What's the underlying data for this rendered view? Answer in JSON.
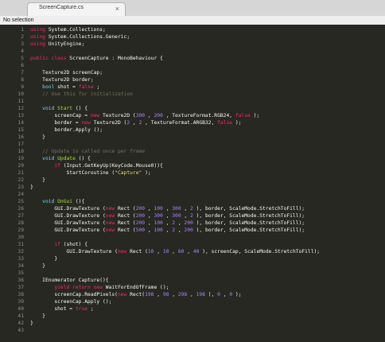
{
  "tab": {
    "label": "ScreenCapture.cs",
    "close_symbol": "×"
  },
  "status": {
    "text": "No selection"
  },
  "colors": {
    "background": "#272822",
    "keyword": "#f92672",
    "type": "#66d9ef",
    "number": "#ae81ff",
    "string": "#e6db74",
    "comment": "#75715e",
    "function": "#a6e22e",
    "text": "#f8f8f2"
  },
  "code": [
    {
      "n": "1",
      "segs": [
        [
          "kw",
          "using"
        ],
        [
          "",
          "System.Collections;"
        ]
      ]
    },
    {
      "n": "2",
      "segs": [
        [
          "kw",
          "using"
        ],
        [
          "",
          "System.Collections.Generic;"
        ]
      ]
    },
    {
      "n": "3",
      "segs": [
        [
          "kw",
          "using"
        ],
        [
          "",
          "UnityEngine;"
        ]
      ]
    },
    {
      "n": "4",
      "segs": []
    },
    {
      "n": "5",
      "segs": [
        [
          "kw",
          "public class"
        ],
        [
          "",
          "ScreenCapture : MonoBehaviour {"
        ]
      ]
    },
    {
      "n": "6",
      "segs": []
    },
    {
      "n": "7",
      "segs": [
        [
          "",
          "    Texture2D screenCap;"
        ]
      ]
    },
    {
      "n": "8",
      "segs": [
        [
          "",
          "    Texture2D border;"
        ]
      ]
    },
    {
      "n": "9",
      "segs": [
        [
          "ty",
          "    bool"
        ],
        [
          "",
          " shot = "
        ],
        [
          "kw",
          "false"
        ],
        [
          "",
          ";"
        ]
      ]
    },
    {
      "n": "10",
      "segs": [
        [
          "cmt",
          "    // Use this for initialization"
        ]
      ]
    },
    {
      "n": "11",
      "segs": []
    },
    {
      "n": "12",
      "segs": [
        [
          "ty",
          "    void"
        ],
        [
          "fn",
          " Start"
        ],
        [
          "",
          " () {"
        ]
      ]
    },
    {
      "n": "13",
      "segs": [
        [
          "",
          "        screenCap = "
        ],
        [
          "kw",
          "new"
        ],
        [
          "",
          " Texture2D ("
        ],
        [
          "num",
          "300"
        ],
        [
          "",
          ", "
        ],
        [
          "num",
          "200"
        ],
        [
          "",
          ", TextureFormat.RGB24, "
        ],
        [
          "kw",
          "false"
        ],
        [
          "",
          ");"
        ]
      ]
    },
    {
      "n": "14",
      "segs": [
        [
          "",
          "        border = "
        ],
        [
          "kw",
          "new"
        ],
        [
          "",
          " Texture2D ("
        ],
        [
          "num",
          "2"
        ],
        [
          "",
          ", "
        ],
        [
          "num",
          "2"
        ],
        [
          "",
          ", TextureFormat.ARGB32, "
        ],
        [
          "kw",
          "false"
        ],
        [
          "",
          ");"
        ]
      ]
    },
    {
      "n": "15",
      "segs": [
        [
          "",
          "        border.Apply ();"
        ]
      ]
    },
    {
      "n": "16",
      "segs": [
        [
          "",
          "    }"
        ]
      ]
    },
    {
      "n": "17",
      "segs": []
    },
    {
      "n": "18",
      "segs": [
        [
          "cmt",
          "    // Update is called once per frame"
        ]
      ]
    },
    {
      "n": "19",
      "segs": [
        [
          "ty",
          "    void"
        ],
        [
          "fn",
          " Update"
        ],
        [
          "",
          " () {"
        ]
      ]
    },
    {
      "n": "20",
      "segs": [
        [
          "kw",
          "        if"
        ],
        [
          "",
          "(Input.GetKeyUp(KeyCode.Mouse0)){"
        ]
      ]
    },
    {
      "n": "21",
      "segs": [
        [
          "",
          "            StartCoroutine ("
        ],
        [
          "str",
          "\"Capture\""
        ],
        [
          "",
          ");"
        ]
      ]
    },
    {
      "n": "22",
      "segs": [
        [
          "",
          "    }"
        ]
      ]
    },
    {
      "n": "23",
      "segs": [
        [
          "",
          "}"
        ]
      ]
    },
    {
      "n": "24",
      "segs": []
    },
    {
      "n": "25",
      "segs": [
        [
          "ty",
          "    void"
        ],
        [
          "fn",
          " OnGui"
        ],
        [
          "",
          "(){"
        ]
      ]
    },
    {
      "n": "26",
      "segs": [
        [
          "",
          "        GUI.DrawTexture ("
        ],
        [
          "kw",
          "new"
        ],
        [
          "",
          " Rect ("
        ],
        [
          "num",
          "200"
        ],
        [
          "",
          ", "
        ],
        [
          "num",
          "100"
        ],
        [
          "",
          ", "
        ],
        [
          "num",
          "300"
        ],
        [
          "",
          ", "
        ],
        [
          "num",
          "2"
        ],
        [
          "",
          "), border, ScaleMode.StretchToFill);"
        ]
      ]
    },
    {
      "n": "27",
      "segs": [
        [
          "",
          "        GUI.DrawTexture ("
        ],
        [
          "kw",
          "new"
        ],
        [
          "",
          " Rect ("
        ],
        [
          "num",
          "200"
        ],
        [
          "",
          ", "
        ],
        [
          "num",
          "300"
        ],
        [
          "",
          ", "
        ],
        [
          "num",
          "300"
        ],
        [
          "",
          ", "
        ],
        [
          "num",
          "2"
        ],
        [
          "",
          "), border, ScaleMode.StretchToFill);"
        ]
      ]
    },
    {
      "n": "28",
      "segs": [
        [
          "",
          "        GUI.DrawTexture ("
        ],
        [
          "kw",
          "new"
        ],
        [
          "",
          " Rect ("
        ],
        [
          "num",
          "200"
        ],
        [
          "",
          ", "
        ],
        [
          "num",
          "100"
        ],
        [
          "",
          ", "
        ],
        [
          "num",
          "2"
        ],
        [
          "",
          ", "
        ],
        [
          "num",
          "200"
        ],
        [
          "",
          "), border, ScaleMode.StretchToFill);"
        ]
      ]
    },
    {
      "n": "29",
      "segs": [
        [
          "",
          "        GUI.DrawTexture ("
        ],
        [
          "kw",
          "new"
        ],
        [
          "",
          " Rect ("
        ],
        [
          "num",
          "500"
        ],
        [
          "",
          ", "
        ],
        [
          "num",
          "100"
        ],
        [
          "",
          ", "
        ],
        [
          "num",
          "2"
        ],
        [
          "",
          ", "
        ],
        [
          "num",
          "200"
        ],
        [
          "",
          "), border, ScaleMode.StretchToFill);"
        ]
      ]
    },
    {
      "n": "30",
      "segs": []
    },
    {
      "n": "31",
      "segs": [
        [
          "kw",
          "        if"
        ],
        [
          "",
          " (shot) {"
        ]
      ]
    },
    {
      "n": "32",
      "segs": [
        [
          "",
          "            GUI.DrawTexture ("
        ],
        [
          "kw",
          "new"
        ],
        [
          "",
          " Rect ("
        ],
        [
          "num",
          "10"
        ],
        [
          "",
          ", "
        ],
        [
          "num",
          "10"
        ],
        [
          "",
          ", "
        ],
        [
          "num",
          "60"
        ],
        [
          "",
          ", "
        ],
        [
          "num",
          "40"
        ],
        [
          "",
          "), screenCap, ScaleMode.StretchToFill);"
        ]
      ]
    },
    {
      "n": "33",
      "segs": [
        [
          "",
          "        }"
        ]
      ]
    },
    {
      "n": "34",
      "segs": [
        [
          "",
          "    }"
        ]
      ]
    },
    {
      "n": "35",
      "segs": []
    },
    {
      "n": "36",
      "segs": [
        [
          "",
          "    IEnumerator Capture(){"
        ]
      ]
    },
    {
      "n": "37",
      "segs": [
        [
          "kw",
          "        yield return new"
        ],
        [
          "",
          " WaitForEndOfFrame ();"
        ]
      ]
    },
    {
      "n": "38",
      "segs": [
        [
          "",
          "        screenCap.ReadPixels("
        ],
        [
          "kw",
          "new"
        ],
        [
          "",
          " Rect("
        ],
        [
          "num",
          "198"
        ],
        [
          "",
          ", "
        ],
        [
          "num",
          "98"
        ],
        [
          "",
          ", "
        ],
        [
          "num",
          "298"
        ],
        [
          "",
          ", "
        ],
        [
          "num",
          "198"
        ],
        [
          "",
          "), "
        ],
        [
          "num",
          "0"
        ],
        [
          "",
          ", "
        ],
        [
          "num",
          "0"
        ],
        [
          "",
          ");"
        ]
      ]
    },
    {
      "n": "39",
      "segs": [
        [
          "",
          "        screenCap.Apply ();"
        ]
      ]
    },
    {
      "n": "40",
      "segs": [
        [
          "",
          "        shot = "
        ],
        [
          "kw",
          "true"
        ],
        [
          "",
          ";"
        ]
      ]
    },
    {
      "n": "41",
      "segs": [
        [
          "",
          "    }"
        ]
      ]
    },
    {
      "n": "42",
      "segs": [
        [
          "",
          "}"
        ]
      ]
    },
    {
      "n": "43",
      "segs": []
    }
  ]
}
